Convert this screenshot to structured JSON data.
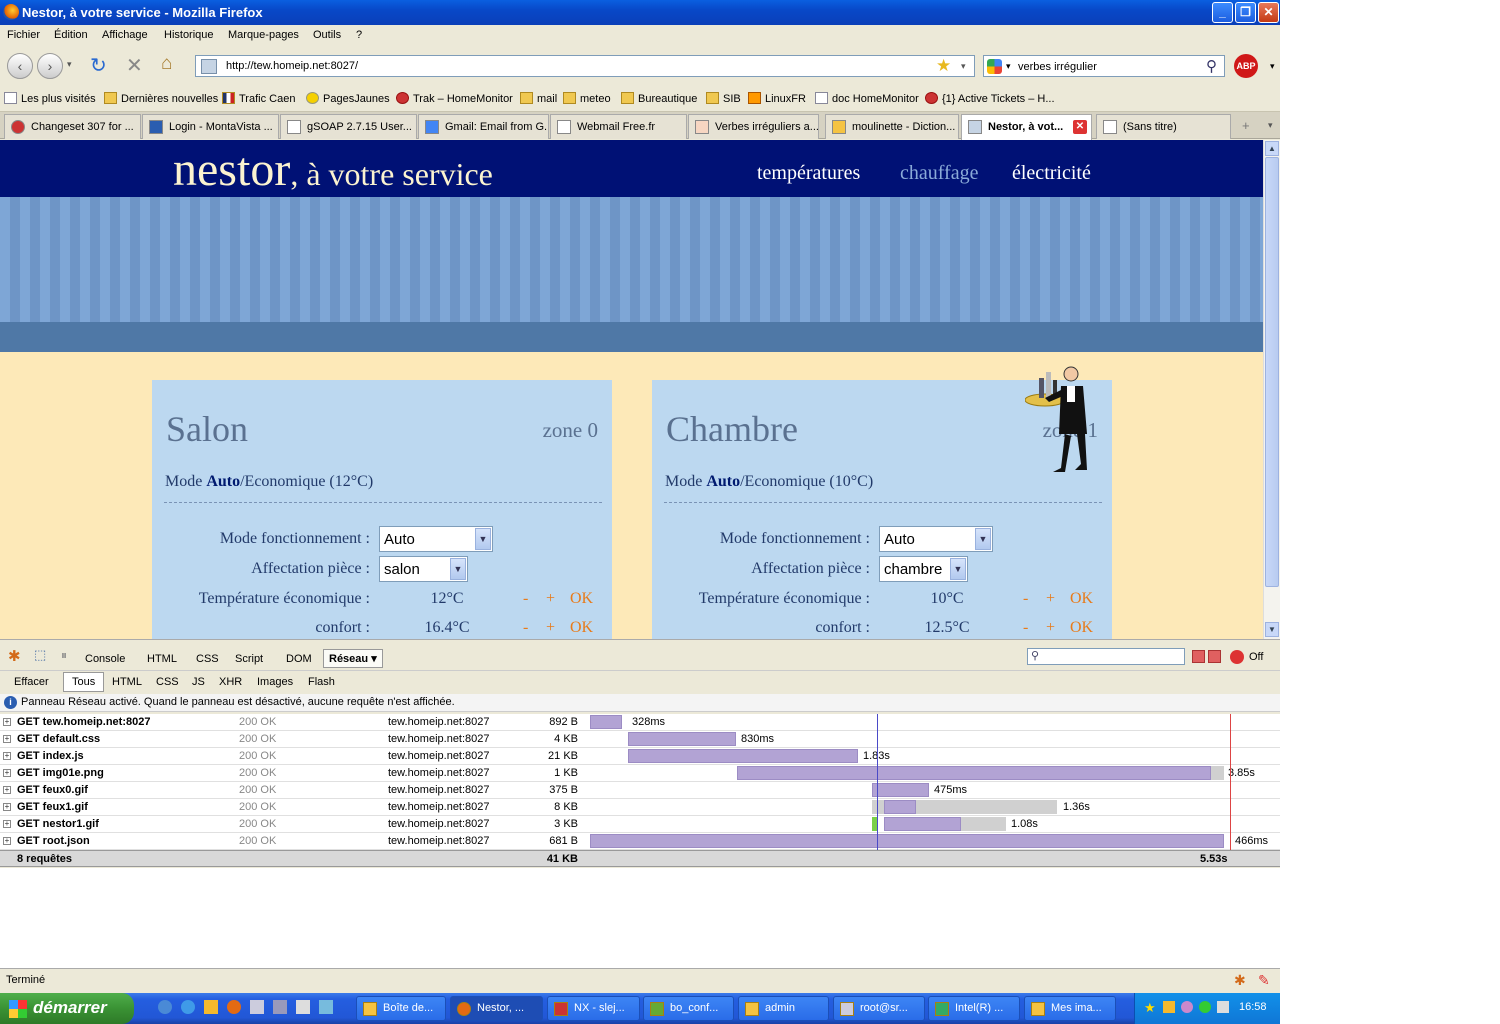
{
  "window": {
    "title": "Nestor, à votre service - Mozilla Firefox"
  },
  "menu": [
    "Fichier",
    "Édition",
    "Affichage",
    "Historique",
    "Marque-pages",
    "Outils",
    "?"
  ],
  "nav": {
    "url": "http://tew.homeip.net:8027/",
    "search": "verbes irrégulier",
    "abp": "ABP"
  },
  "bookmarks": [
    "Les plus visités",
    "Dernières nouvelles",
    "Trafic Caen",
    "PagesJaunes",
    "Trak – HomeMonitor",
    "mail",
    "meteo",
    "Bureautique",
    "SIB",
    "LinuxFR",
    "doc HomeMonitor",
    "{1} Active Tickets – H..."
  ],
  "tabs": [
    "Changeset 307 for ...",
    "Login - MontaVista ...",
    "gSOAP 2.7.15 User...",
    "Gmail: Email from G...",
    "Webmail Free.fr",
    "Verbes irréguliers a...",
    "moulinette - Diction...",
    "Nestor, à vot...",
    "(Sans titre)"
  ],
  "site": {
    "logo_main": "nestor",
    "logo_rest": ", à votre service",
    "nav": [
      "températures",
      "chauffage",
      "électricité"
    ],
    "accent": "#e87b1a",
    "zones": [
      {
        "name": "Salon",
        "zone": "zone 0",
        "mode_prefix": "Mode ",
        "mode_bold": "Auto",
        "mode_suffix": "/Economique (12°C)",
        "lbl_mode": "Mode fonctionnement :",
        "sel_mode": "Auto",
        "lbl_aff": "Affectation pièce :",
        "sel_aff": "salon",
        "lbl_eco": "Température économique :",
        "val_eco": "12°C",
        "lbl_conf": "confort :",
        "val_conf": "16.4°C",
        "minus": "-",
        "plus": "+",
        "ok": "OK"
      },
      {
        "name": "Chambre",
        "zone": "zone 1",
        "mode_prefix": "Mode ",
        "mode_bold": "Auto",
        "mode_suffix": "/Economique (10°C)",
        "lbl_mode": "Mode fonctionnement :",
        "sel_mode": "Auto",
        "lbl_aff": "Affectation pièce :",
        "sel_aff": "chambre",
        "lbl_eco": "Température économique :",
        "val_eco": "10°C",
        "lbl_conf": "confort :",
        "val_conf": "12.5°C",
        "minus": "-",
        "plus": "+",
        "ok": "OK"
      }
    ]
  },
  "firebug": {
    "tabs": [
      "Console",
      "HTML",
      "CSS",
      "Script",
      "DOM",
      "Réseau ▾"
    ],
    "off": "Off",
    "sub": [
      "Effacer",
      "Tous",
      "HTML",
      "CSS",
      "JS",
      "XHR",
      "Images",
      "Flash"
    ],
    "info": "Panneau Réseau activé. Quand le panneau est désactivé, aucune requête n'est affichée.",
    "requests": [
      {
        "url": "GET tew.homeip.net:8027",
        "status": "200 OK",
        "domain": "tew.homeip.net:8027",
        "size": "892 B",
        "time": "328ms"
      },
      {
        "url": "GET default.css",
        "status": "200 OK",
        "domain": "tew.homeip.net:8027",
        "size": "4 KB",
        "time": "830ms"
      },
      {
        "url": "GET index.js",
        "status": "200 OK",
        "domain": "tew.homeip.net:8027",
        "size": "21 KB",
        "time": "1.83s"
      },
      {
        "url": "GET img01e.png",
        "status": "200 OK",
        "domain": "tew.homeip.net:8027",
        "size": "1 KB",
        "time": "3.85s"
      },
      {
        "url": "GET feux0.gif",
        "status": "200 OK",
        "domain": "tew.homeip.net:8027",
        "size": "375 B",
        "time": "475ms"
      },
      {
        "url": "GET feux1.gif",
        "status": "200 OK",
        "domain": "tew.homeip.net:8027",
        "size": "8 KB",
        "time": "1.36s"
      },
      {
        "url": "GET nestor1.gif",
        "status": "200 OK",
        "domain": "tew.homeip.net:8027",
        "size": "3 KB",
        "time": "1.08s"
      },
      {
        "url": "GET root.json",
        "status": "200 OK",
        "domain": "tew.homeip.net:8027",
        "size": "681 B",
        "time": "466ms"
      }
    ],
    "total_label": "8 requêtes",
    "total_size": "41 KB",
    "total_time": "5.53s"
  },
  "status": "Terminé",
  "taskbar": {
    "start": "démarrer",
    "items": [
      "Boîte de...",
      "Nestor, ...",
      "NX - slej...",
      "bo_conf...",
      "admin",
      "root@sr...",
      "Intel(R) ...",
      "Mes ima..."
    ],
    "clock": "16:58"
  }
}
